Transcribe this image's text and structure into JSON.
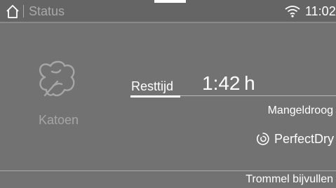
{
  "status_bar": {
    "title": "Status",
    "time": "11:02",
    "home_icon": "home-icon",
    "wifi_icon": "wifi-icon"
  },
  "program": {
    "icon": "cotton-icon",
    "name": "Katoen"
  },
  "remaining": {
    "label": "Resttijd",
    "value": "1:42 h"
  },
  "drying_level": "Mangeldroog",
  "perfectdry": {
    "icon": "perfectdry-icon",
    "label": "PerfectDry"
  },
  "bottom_action": "Trommel bijvullen",
  "colors": {
    "background": "#727272",
    "status_bar": "#656565",
    "dim_text": "#a9a9a9",
    "text": "#ffffff"
  }
}
